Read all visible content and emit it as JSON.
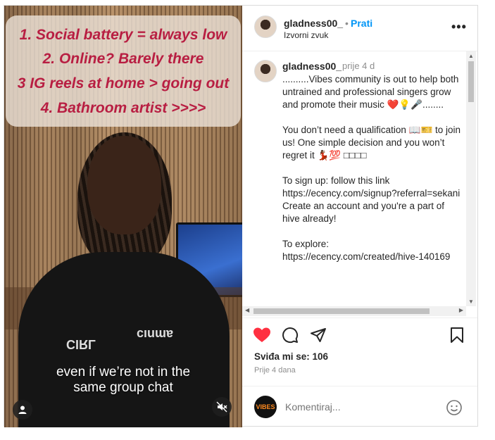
{
  "video": {
    "overlay_lines": [
      "1. Social battery = always low",
      "2. Online? Barely there",
      "3 IG reels at home > going out",
      "4. Bathroom artist >>>>"
    ],
    "caption_lines": [
      "even if we’re not in the",
      "same group chat"
    ],
    "shirt_text_left": "CIRL",
    "shirt_text_right": "cıuɯɐ",
    "tag_icon": "person-icon",
    "mute_icon": "muted-speaker-icon"
  },
  "header": {
    "username": "gladness00_",
    "separator": "•",
    "follow_label": "Prati",
    "audio_label": "Izvorni zvuk",
    "more_label": "•••"
  },
  "comment": {
    "username": "gladness00_",
    "time": "prije 4 d",
    "lines": [
      "..........Vibes community is out to help both untrained and professional singers grow and promote their music ❤️💡🎤........",
      "",
      "You don’t need a qualification 📖🎫 to join us! One simple decision and you won’t regret it 💃🏾💯 □□□□",
      "",
      "To sign up: follow this link https://ecency.com/signup?referral=sekani",
      "Create an account and you're a part of hive already!",
      "",
      "To explore: https://ecency.com/created/hive-140169"
    ]
  },
  "actions": {
    "likes_label": "Sviđa mi se: 106",
    "posted_label": "Prije 4 dana",
    "like_color": "#ff3040"
  },
  "add_comment": {
    "avatar_text": "VIBES",
    "placeholder": "Komentiraj..."
  }
}
